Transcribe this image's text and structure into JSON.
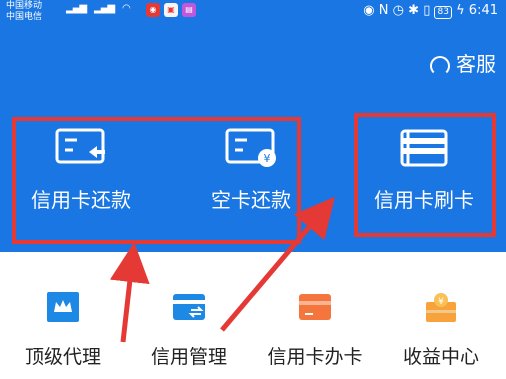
{
  "status_bar": {
    "carrier1": "中国移动",
    "carrier2": "中国电信",
    "time": "6:41",
    "battery": "83"
  },
  "header": {
    "service_label": "客服"
  },
  "actions": [
    {
      "label": "信用卡还款"
    },
    {
      "label": "空卡还款"
    },
    {
      "label": "信用卡刷卡"
    }
  ],
  "grid": [
    {
      "label": "顶级代理",
      "color": "#1e88e5"
    },
    {
      "label": "信用管理",
      "color": "#1e88e5"
    },
    {
      "label": "信用卡办卡",
      "color": "#f4763d"
    },
    {
      "label": "收益中心",
      "color": "#f7a23a"
    }
  ],
  "colors": {
    "header_bg": "#1976e3",
    "annotation_red": "#e53935"
  }
}
